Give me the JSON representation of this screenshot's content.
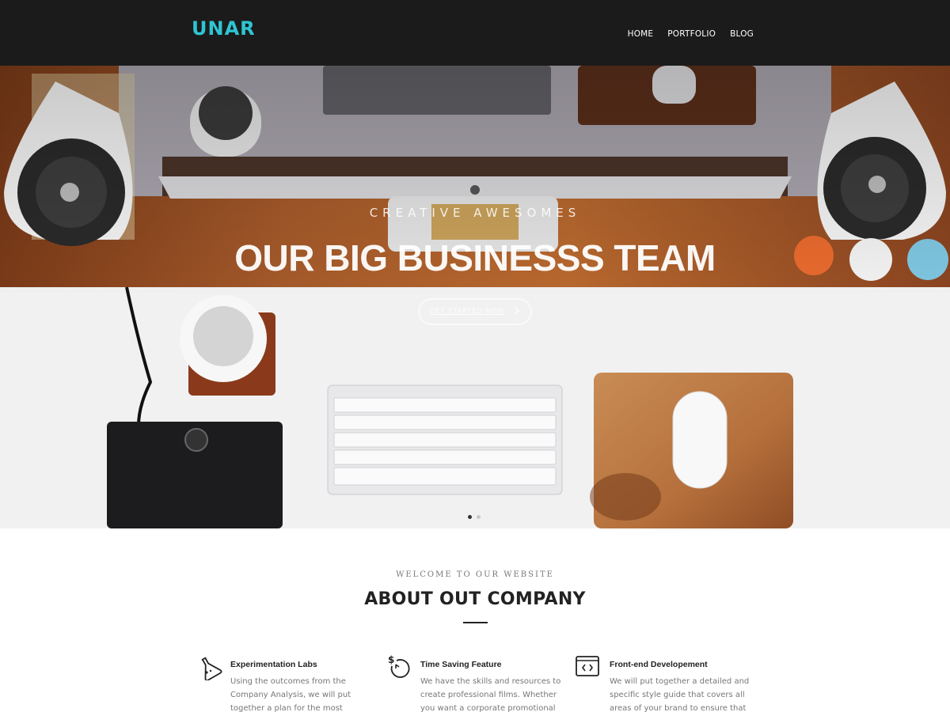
{
  "brand": {
    "logo": "UNAR",
    "accent": "#2ec5d3"
  },
  "nav": {
    "items": [
      "HOME",
      "PORTFOLIO",
      "BLOG"
    ]
  },
  "hero": {
    "eyebrow": "CREATIVE AWESOMES",
    "title": "OUR BIG BUSINESSS TEAM",
    "cta_label": "GET STARTED NOW",
    "cta_icon": "chevron-right-icon",
    "slides": 2,
    "active_slide": 1
  },
  "about": {
    "welcome": "WELCOME TO OUR WEBSITE",
    "title": "ABOUT OUT COMPANY"
  },
  "features": [
    {
      "icon": "flask-icon",
      "title": "Experimentation Labs",
      "text": "Using the outcomes from the Company Analysis, we will put together a plan for the most effective marketing strategy."
    },
    {
      "icon": "dollar-timer-icon",
      "title": "Time Saving Feature",
      "text": "We have the skills and resources to create professional films. Whether you want a corporate promotional film or a"
    },
    {
      "icon": "code-window-icon",
      "title": "Front-end Developement",
      "text": "We will put together a detailed and specific style guide that covers all areas of your brand to ensure that anything"
    }
  ]
}
